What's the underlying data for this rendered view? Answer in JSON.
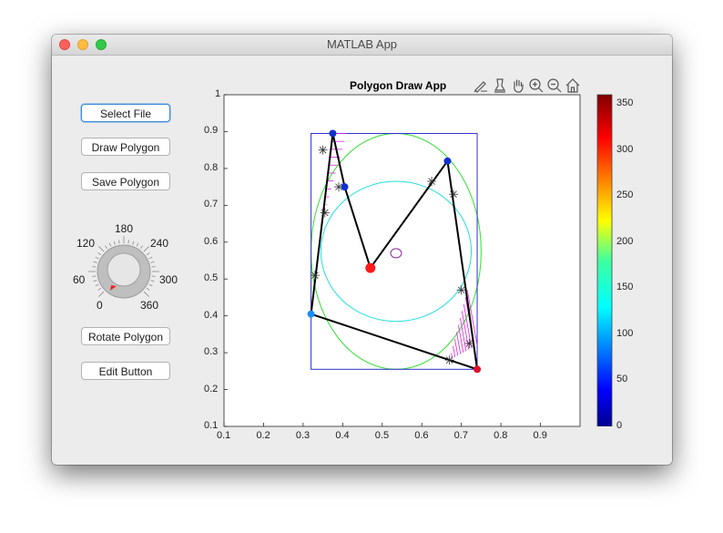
{
  "window": {
    "title": "MATLAB App"
  },
  "buttons": {
    "select_file": "Select File",
    "draw_polygon": "Draw Polygon",
    "save_polygon": "Save Polygon",
    "rotate_polygon": "Rotate Polygon",
    "edit_button": "Edit Button"
  },
  "knob": {
    "labels": [
      "0",
      "60",
      "120",
      "180",
      "240",
      "300",
      "360"
    ],
    "value": 0,
    "range": [
      0,
      360
    ]
  },
  "plot": {
    "title": "Polygon Draw App",
    "toolbar": [
      "brush-icon",
      "data-tips-icon",
      "pan-icon",
      "zoom-in-icon",
      "zoom-out-icon",
      "home-icon"
    ]
  },
  "axes": {
    "x_ticks": [
      "0.1",
      "0.2",
      "0.3",
      "0.4",
      "0.5",
      "0.6",
      "0.7",
      "0.8",
      "0.9"
    ],
    "y_ticks": [
      "0.1",
      "0.2",
      "0.3",
      "0.4",
      "0.5",
      "0.6",
      "0.7",
      "0.8",
      "0.9",
      "1"
    ]
  },
  "colorbar": {
    "ticks": [
      "0",
      "50",
      "100",
      "150",
      "200",
      "250",
      "300",
      "350"
    ],
    "range": [
      0,
      360
    ],
    "colormap": "jet"
  },
  "chart_data": {
    "type": "scatter",
    "xlim": [
      0.1,
      1.0
    ],
    "ylim": [
      0.1,
      1.0
    ],
    "polygon": [
      [
        0.32,
        0.405
      ],
      [
        0.375,
        0.895
      ],
      [
        0.405,
        0.75
      ],
      [
        0.47,
        0.53
      ],
      [
        0.665,
        0.82
      ],
      [
        0.74,
        0.255
      ]
    ],
    "vertex_colors": [
      "#1a8cff",
      "#1030d0",
      "#1030d0",
      "#ff1a1a",
      "#1030d0",
      "#e0102a"
    ],
    "centroid": [
      0.47,
      0.53
    ],
    "small_circle_center": [
      0.535,
      0.57
    ],
    "bounding_box": [
      [
        0.32,
        0.255
      ],
      [
        0.74,
        0.895
      ]
    ],
    "circles": [
      {
        "center": [
          0.535,
          0.575
        ],
        "radius_x": 0.215,
        "radius_y": 0.32,
        "color": "#33dd33"
      },
      {
        "center": [
          0.535,
          0.575
        ],
        "radius_x": 0.19,
        "radius_y": 0.19,
        "color": "#22dddd"
      }
    ],
    "star_markers": [
      [
        0.35,
        0.85
      ],
      [
        0.39,
        0.75
      ],
      [
        0.355,
        0.68
      ],
      [
        0.33,
        0.51
      ],
      [
        0.625,
        0.765
      ],
      [
        0.68,
        0.73
      ],
      [
        0.7,
        0.47
      ],
      [
        0.72,
        0.325
      ],
      [
        0.67,
        0.28
      ]
    ]
  }
}
